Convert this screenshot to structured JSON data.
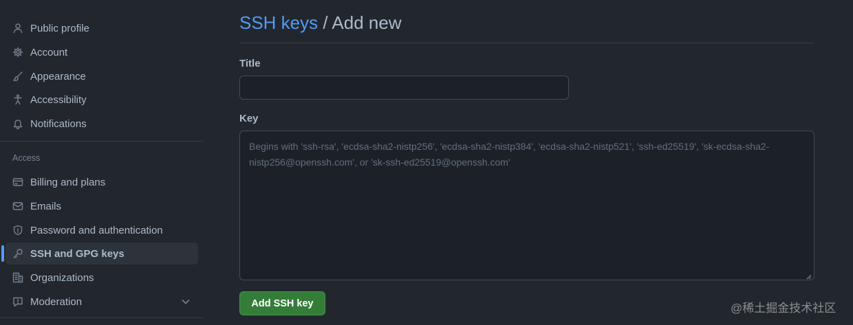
{
  "sidebar": {
    "items": [
      {
        "label": "Public profile",
        "icon": "person-icon"
      },
      {
        "label": "Account",
        "icon": "gear-icon"
      },
      {
        "label": "Appearance",
        "icon": "paintbrush-icon"
      },
      {
        "label": "Accessibility",
        "icon": "accessibility-icon"
      },
      {
        "label": "Notifications",
        "icon": "bell-icon"
      }
    ],
    "access_heading": "Access",
    "access_items": [
      {
        "label": "Billing and plans",
        "icon": "credit-card-icon"
      },
      {
        "label": "Emails",
        "icon": "mail-icon"
      },
      {
        "label": "Password and authentication",
        "icon": "shield-icon"
      },
      {
        "label": "SSH and GPG keys",
        "icon": "key-icon",
        "active": true
      },
      {
        "label": "Organizations",
        "icon": "organization-icon"
      },
      {
        "label": "Moderation",
        "icon": "report-icon",
        "expandable": true
      }
    ]
  },
  "main": {
    "breadcrumb_link": "SSH keys",
    "breadcrumb_separator": "/",
    "breadcrumb_current": "Add new",
    "title_label": "Title",
    "title_value": "",
    "key_label": "Key",
    "key_value": "",
    "key_placeholder": "Begins with 'ssh-rsa', 'ecdsa-sha2-nistp256', 'ecdsa-sha2-nistp384', 'ecdsa-sha2-nistp521', 'ssh-ed25519', 'sk-ecdsa-sha2-nistp256@openssh.com', or 'sk-ssh-ed25519@openssh.com'",
    "submit_label": "Add SSH key"
  },
  "watermark": "@稀土掘金技术社区",
  "colors": {
    "background": "#22272e",
    "link": "#539bf5",
    "primary_button": "#347d39",
    "active_indicator": "#539bf5"
  }
}
